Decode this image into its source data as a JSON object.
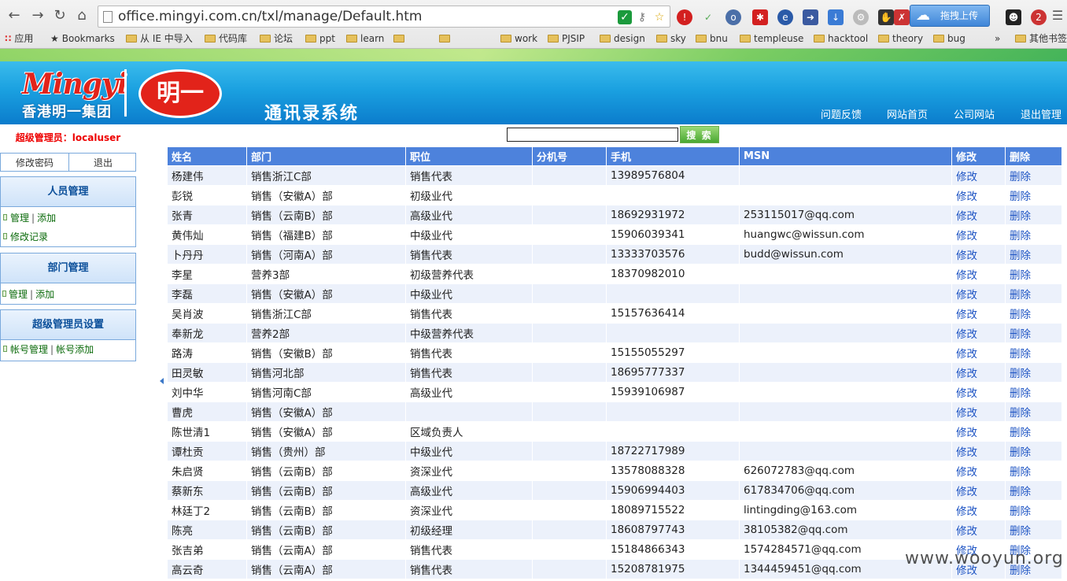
{
  "browser": {
    "url": "office.mingyi.com.cn/txl/manage/Default.htm",
    "upload_label": "拖拽上传",
    "bookmarks_other": "其他书签",
    "bookmarks": [
      "应用",
      "Bookmarks",
      "从 IE 中导入",
      "代码库",
      "论坛",
      "ppt",
      "learn",
      "",
      "",
      "work",
      "PJSIP",
      "design",
      "sky",
      "bnu",
      "templeuse",
      "hacktool",
      "theory",
      "bug"
    ],
    "more": "»"
  },
  "header": {
    "logo_en": "Mingyi",
    "logo_cn": "香港明一集团",
    "logo_seal": "明一",
    "title": "通讯录系统",
    "nav": [
      "问题反馈",
      "网站首页",
      "公司网站",
      "退出管理"
    ]
  },
  "sidebar": {
    "admin_label": "超级管理员：localuser",
    "change_password": "修改密码",
    "logout": "退出",
    "panels": [
      {
        "title": "人员管理",
        "lines": [
          [
            "管理",
            "添加"
          ],
          [
            "修改记录"
          ]
        ]
      },
      {
        "title": "部门管理",
        "lines": [
          [
            "管理",
            "添加"
          ]
        ]
      },
      {
        "title": "超级管理员设置",
        "lines": [
          [
            "帐号管理",
            "帐号添加"
          ]
        ]
      }
    ]
  },
  "search": {
    "value": "",
    "button": "搜 索"
  },
  "table": {
    "columns": [
      "姓名",
      "部门",
      "职位",
      "分机号",
      "手机",
      "MSN",
      "修改",
      "删除"
    ],
    "edit_label": "修改",
    "delete_label": "删除",
    "rows": [
      [
        "杨建伟",
        "销售浙江C部",
        "销售代表",
        "",
        "13989576804",
        ""
      ],
      [
        "彭锐",
        "销售（安徽A）部",
        "初级业代",
        "",
        "",
        ""
      ],
      [
        "张青",
        "销售（云南B）部",
        "高级业代",
        "",
        "18692931972",
        "253115017@qq.com"
      ],
      [
        "黄伟灿",
        "销售（福建B）部",
        "中级业代",
        "",
        "15906039341",
        "huangwc@wissun.com"
      ],
      [
        "卜丹丹",
        "销售（河南A）部",
        "销售代表",
        "",
        "13333703576",
        "budd@wissun.com"
      ],
      [
        "李星",
        "营养3部",
        "初级营养代表",
        "",
        "18370982010",
        ""
      ],
      [
        "李磊",
        "销售（安徽A）部",
        "中级业代",
        "",
        "",
        ""
      ],
      [
        "吴肖波",
        "销售浙江C部",
        "销售代表",
        "",
        "15157636414",
        ""
      ],
      [
        "奉新龙",
        "营养2部",
        "中级营养代表",
        "",
        "",
        ""
      ],
      [
        "路涛",
        "销售（安徽B）部",
        "销售代表",
        "",
        "15155055297",
        ""
      ],
      [
        "田灵敏",
        "销售河北部",
        "销售代表",
        "",
        "18695777337",
        ""
      ],
      [
        "刘中华",
        "销售河南C部",
        "高级业代",
        "",
        "15939106987",
        ""
      ],
      [
        "曹虎",
        "销售（安徽A）部",
        "",
        "",
        "",
        ""
      ],
      [
        "陈世清1",
        "销售（安徽A）部",
        "区域负责人",
        "",
        "",
        ""
      ],
      [
        "谭杜贡",
        "销售（贵州）部",
        "中级业代",
        "",
        "18722717989",
        ""
      ],
      [
        "朱启贤",
        "销售（云南B）部",
        "资深业代",
        "",
        "13578088328",
        "626072783@qq.com"
      ],
      [
        "蔡新东",
        "销售（云南B）部",
        "高级业代",
        "",
        "15906994403",
        "617834706@qq.com"
      ],
      [
        "林廷丁2",
        "销售（云南B）部",
        "资深业代",
        "",
        "18089715522",
        "lintingding@163.com"
      ],
      [
        "陈亮",
        "销售（云南B）部",
        "初级经理",
        "",
        "18608797743",
        "38105382@qq.com"
      ],
      [
        "张吉弟",
        "销售（云南A）部",
        "销售代表",
        "",
        "15184866343",
        "1574284571@qq.com"
      ],
      [
        "高云奇",
        "销售（云南A）部",
        "销售代表",
        "",
        "15208781975",
        "1344459451@qq.com"
      ]
    ]
  },
  "watermark": "www.wooyun.org",
  "colors": {
    "header_row": "#4d82dc",
    "stripe": "#ecf1fb",
    "link": "#1f55c4",
    "admin": "#e00000"
  }
}
